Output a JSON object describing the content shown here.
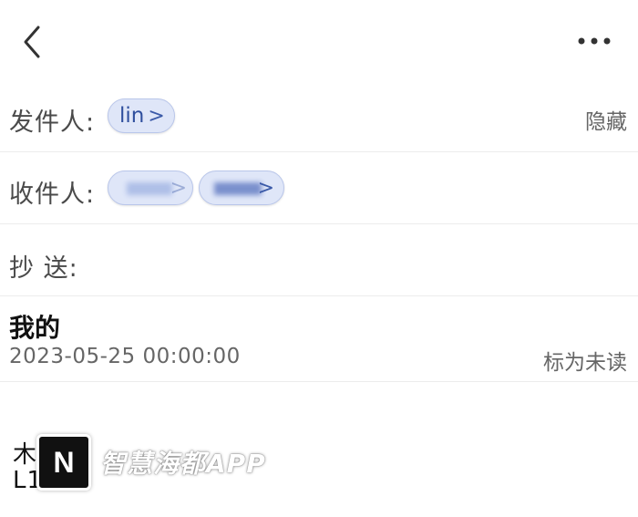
{
  "header": {
    "back_icon": "chevron-left-icon",
    "more_icon": "more-horizontal-icon"
  },
  "sender": {
    "label": "发件人:",
    "chip_name": "lin",
    "chevron": ">",
    "hide_label": "隐藏"
  },
  "recipients": {
    "label": "收件人:",
    "chevron": ">"
  },
  "cc": {
    "label": "抄 送:"
  },
  "message": {
    "subject": "我的",
    "datetime": "2023-05-25 00:00:00",
    "mark_unread_label": "标为未读",
    "body_line1": "木",
    "body_line2": "L1    0L"
  },
  "watermark": {
    "logo_letter": "N",
    "text": "智慧海都APP"
  },
  "colors": {
    "chip_bg": "#dfe6f8",
    "chip_border": "#b9c6ea",
    "chip_text": "#2f4f9e",
    "divider": "#ececec"
  }
}
